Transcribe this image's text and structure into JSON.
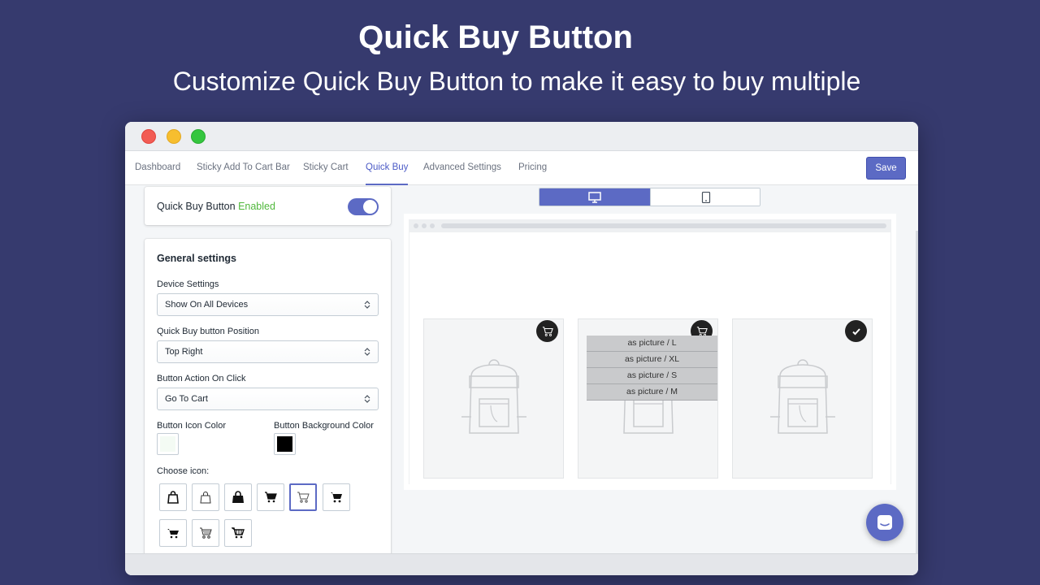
{
  "hero": {
    "title": "Quick Buy Button",
    "subtitle": "Customize Quick Buy Button to make it easy to buy multiple"
  },
  "window": {
    "controls": [
      "close",
      "minimize",
      "maximize"
    ]
  },
  "nav": {
    "tabs": [
      {
        "label": "Dashboard",
        "active": false
      },
      {
        "label": "Sticky Add To Cart Bar",
        "active": false
      },
      {
        "label": "Sticky Cart",
        "active": false
      },
      {
        "label": "Quick Buy",
        "active": true
      },
      {
        "label": "Advanced Settings",
        "active": false
      },
      {
        "label": "Pricing",
        "active": false
      }
    ],
    "save_label": "Save"
  },
  "quick_buy_card": {
    "label": "Quick Buy Button",
    "status": "Enabled",
    "toggle_on": true
  },
  "general_settings": {
    "title": "General settings",
    "device_settings": {
      "label": "Device Settings",
      "value": "Show On All Devices"
    },
    "position": {
      "label": "Quick Buy button Position",
      "value": "Top Right"
    },
    "action": {
      "label": "Button Action On Click",
      "value": "Go To Cart"
    },
    "icon_color": {
      "label": "Button Icon Color",
      "value": "#f4fbf4"
    },
    "bg_color": {
      "label": "Button Background Color",
      "value": "#000000"
    },
    "choose_icon_label": "Choose icon:",
    "icons": [
      "shopping-bag-outline-icon",
      "shopping-bag-thin-icon",
      "shopping-bag-filled-icon",
      "cart-filled-icon",
      "cart-outline-icon",
      "cart-filled-small-icon",
      "cart-truck-icon",
      "cart-wheels-icon",
      "cart-basket-icon"
    ],
    "selected_icon": 4
  },
  "preview": {
    "device_options": [
      "desktop-icon",
      "mobile-icon"
    ],
    "active_device": "desktop",
    "products": [
      {
        "badge": "cart-icon"
      },
      {
        "badge": "cart-icon",
        "variants": [
          "as picture / L",
          "as picture / XL",
          "as picture / S",
          "as picture / M"
        ]
      },
      {
        "badge": "check-icon"
      }
    ]
  },
  "colors": {
    "brand": "#5c6ac4",
    "enabled": "#50b83c",
    "background": "#363a6e"
  },
  "chat": {
    "icon": "chat-icon"
  }
}
